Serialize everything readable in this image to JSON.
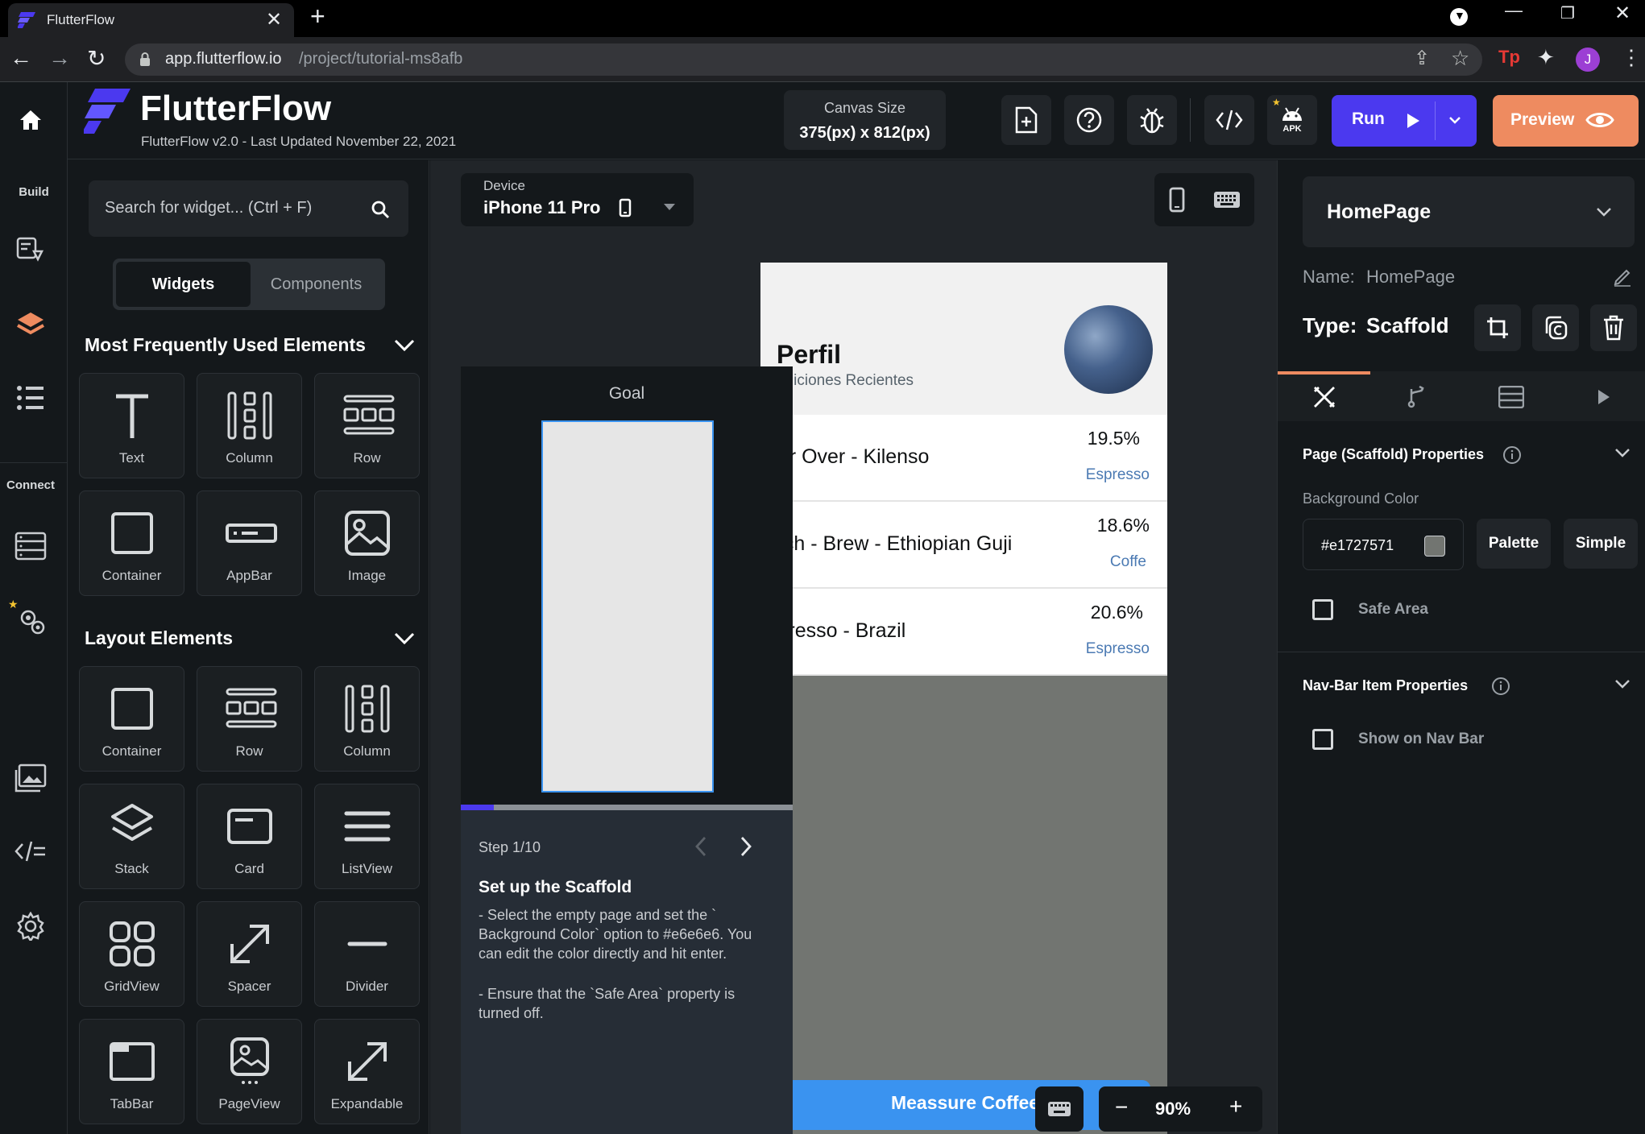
{
  "browser": {
    "tab_title": "FlutterFlow",
    "url_host": "app.flutterflow.io",
    "url_path": "/project/tutorial-ms8afb",
    "profile_initial": "J",
    "ext_badge": "Tp"
  },
  "header": {
    "brand": "FlutterFlow",
    "version": "FlutterFlow v2.0 - Last Updated November 22, 2021",
    "canvas_size_label": "Canvas Size",
    "canvas_size_value": "375(px) x 812(px)",
    "apk_label": "APK",
    "run_label": "Run",
    "preview_label": "Preview"
  },
  "rail": {
    "build_label": "Build",
    "connect_label": "Connect"
  },
  "left": {
    "search_placeholder": "Search for widget...  (Ctrl + F)",
    "tab_widgets": "Widgets",
    "tab_components": "Components",
    "section1_title": "Most Frequently Used Elements",
    "section1_items": [
      "Text",
      "Column",
      "Row",
      "Container",
      "AppBar",
      "Image"
    ],
    "section2_title": "Layout Elements",
    "section2_items": [
      "Container",
      "Row",
      "Column",
      "Stack",
      "Card",
      "ListView",
      "GridView",
      "Spacer",
      "Divider",
      "TabBar",
      "PageView",
      "Expandable"
    ]
  },
  "canvas": {
    "device_label": "Device",
    "device_value": "iPhone 11 Pro",
    "zoom": "90%",
    "phone": {
      "title": "Perfil",
      "subtitle": "ediciones Recientes",
      "items": [
        {
          "name": "our Over - Kilenso",
          "pct": "19.5%",
          "type": "Espresso"
        },
        {
          "name": "atch - Brew - Ethiopian Guji",
          "pct": "18.6%",
          "type": "Coffe"
        },
        {
          "name": "spresso - Brazil",
          "pct": "20.6%",
          "type": "Espresso"
        }
      ],
      "button_label": "Meassure Coffee"
    }
  },
  "tutorial": {
    "goal_label": "Goal",
    "progress": 0.1,
    "step_label": "Step 1/10",
    "title": "Set up the Scaffold",
    "text1": "- Select the empty page and set the ` Background Color` option to #e6e6e6. You can edit the color directly and hit enter.",
    "text2": "- Ensure that the `Safe Area` property is turned off."
  },
  "right": {
    "page_select": "HomePage",
    "name_label": "Name:",
    "name_value": "HomePage",
    "type_label": "Type:",
    "type_value": "Scaffold",
    "section1_title": "Page (Scaffold) Properties",
    "bg_color_label": "Background Color",
    "bg_color_value": "#e1727571",
    "palette_label": "Palette",
    "simple_label": "Simple",
    "safe_area_label": "Safe Area",
    "section2_title": "Nav-Bar Item Properties",
    "show_nav_label": "Show on Nav Bar"
  },
  "colors": {
    "accent": "#4b39ef",
    "preview": "#ee8b60",
    "phone_button": "#3a93f0",
    "swatch": "#727571"
  }
}
